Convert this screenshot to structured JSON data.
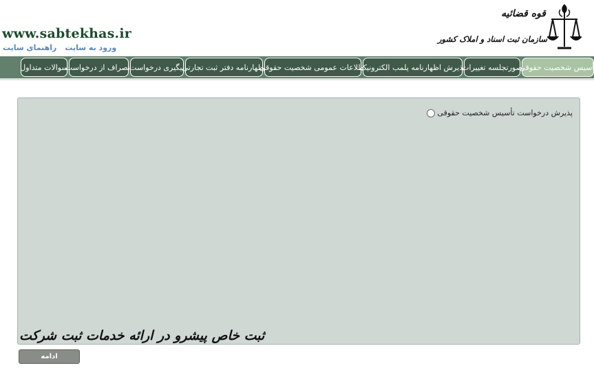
{
  "header": {
    "site_url": "www.sabtekhas.ir",
    "links": [
      "ورود به سایت",
      "راهنمای سایت"
    ],
    "logo": {
      "line1": "قوه قضائیه",
      "line2": "سازمان ثبت اسناد و املاک کشور",
      "emblem_icon": "scales-of-justice-icon"
    }
  },
  "nav": {
    "tabs": [
      {
        "label": "تأسیس شخصیت حقوقی",
        "active": true
      },
      {
        "label": "صورتجلسه تغییرات",
        "active": false
      },
      {
        "label": "پذیرش اظهارنامه پلمب الکترونیک",
        "active": false
      },
      {
        "label": "اطلاعات عمومی شخصیت حقوقی",
        "active": false
      },
      {
        "label": "اظهارنامه دفتر ثبت تجارتی",
        "active": false
      },
      {
        "label": "پیگیری درخواست",
        "active": false
      },
      {
        "label": "انصراف از درخواست",
        "active": false
      },
      {
        "label": "سوالات متداول",
        "active": false
      }
    ]
  },
  "content": {
    "option_label": "پذیرش درخواست تأسیس شخصیت حقوقی",
    "slogan": "ثبت خاص پیشرو در ارائه خدمات ثبت شرکت"
  },
  "footer": {
    "continue_label": "ادامه"
  },
  "colors": {
    "nav_bg": "#62806c",
    "tab_bg": "#3f5a48",
    "tab_active_bg": "#a8c4a3",
    "panel_bg": "#d0d8d4",
    "url_color": "#1e4a2e",
    "link_color": "#5a87b8"
  }
}
